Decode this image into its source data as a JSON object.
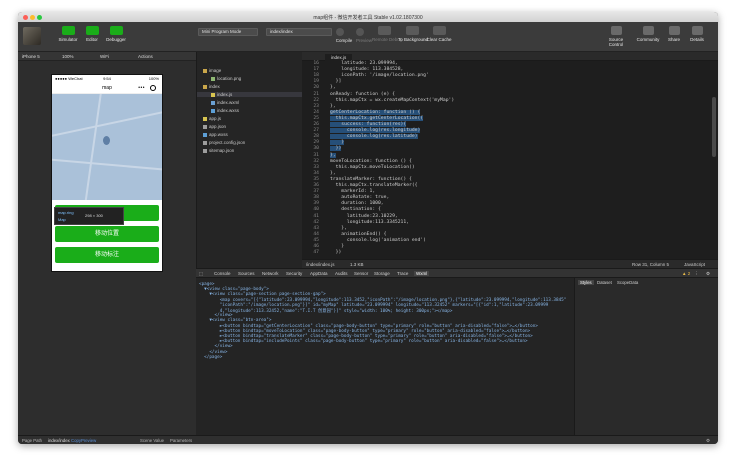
{
  "window": {
    "title": "map组件 - 微信开发者工具 Stable v1.02.1807300"
  },
  "toolbar": {
    "simulator": "Simulator",
    "editor": "Editor",
    "debugger": "Debugger",
    "mode": "Mini Program Mode",
    "page": "index/index",
    "compile": "Compile",
    "preview": "Preview",
    "remote": "Remote Debug",
    "background": "To Background",
    "clear": "Clear Cache",
    "source": "Source Control",
    "community": "Community",
    "share": "Share",
    "details": "Details"
  },
  "subbar": {
    "device": "iPhone 5",
    "zoom": "100%",
    "network": "WiFi",
    "actions": "Actions"
  },
  "phone": {
    "carrier": "●●●●● WeChat",
    "time": "9:54",
    "battery": "100%",
    "nav_title": "map",
    "nav_dots": "•••",
    "tooltip_a": "map.ring",
    "tooltip_b": "Map",
    "tooltip_size": "298 × 300",
    "buttons": [
      "获取位置",
      "移动位置",
      "移动标注"
    ]
  },
  "explorer": {
    "items": [
      {
        "label": "image",
        "kind": "folder"
      },
      {
        "label": "location.png",
        "kind": "png"
      },
      {
        "label": "index",
        "kind": "folder"
      },
      {
        "label": "index.js",
        "kind": "js"
      },
      {
        "label": "index.wxml",
        "kind": "wxml"
      },
      {
        "label": "index.wxss",
        "kind": "wxss"
      },
      {
        "label": "app.js",
        "kind": "js"
      },
      {
        "label": "app.json",
        "kind": "json"
      },
      {
        "label": "app.wxss",
        "kind": "wxss"
      },
      {
        "label": "project.config.json",
        "kind": "json"
      },
      {
        "label": "sitemap.json",
        "kind": "json"
      }
    ]
  },
  "editor": {
    "tab": "index.js",
    "lines": [
      {
        "n": "16",
        "t": "    latitude: 23.099994,",
        "hl": false
      },
      {
        "n": "17",
        "t": "    longitude: 113.384528,",
        "hl": false
      },
      {
        "n": "18",
        "t": "    iconPath: '/image/location.png'",
        "hl": false
      },
      {
        "n": "19",
        "t": "  }]",
        "hl": false
      },
      {
        "n": "20",
        "t": "},",
        "hl": false
      },
      {
        "n": "21",
        "t": "onReady: function (e) {",
        "hl": false
      },
      {
        "n": "22",
        "t": "  this.mapCtx = wx.createMapContext('myMap')",
        "hl": false
      },
      {
        "n": "23",
        "t": "},",
        "hl": false
      },
      {
        "n": "24",
        "t": "getCenterLocation: function () {",
        "hl": true
      },
      {
        "n": "25",
        "t": "  this.mapCtx.getCenterLocation({",
        "hl": true
      },
      {
        "n": "26",
        "t": "    success: function(res){",
        "hl": true
      },
      {
        "n": "27",
        "t": "      console.log(res.longitude)",
        "hl": true
      },
      {
        "n": "28",
        "t": "      console.log(res.latitude)",
        "hl": true
      },
      {
        "n": "29",
        "t": "    }",
        "hl": true
      },
      {
        "n": "30",
        "t": "  })",
        "hl": true
      },
      {
        "n": "31",
        "t": "},",
        "hl": true
      },
      {
        "n": "32",
        "t": "moveToLocation: function () {",
        "hl": false
      },
      {
        "n": "33",
        "t": "  this.mapCtx.moveToLocation()",
        "hl": false
      },
      {
        "n": "34",
        "t": "},",
        "hl": false
      },
      {
        "n": "35",
        "t": "translateMarker: function() {",
        "hl": false
      },
      {
        "n": "36",
        "t": "  this.mapCtx.translateMarker({",
        "hl": false
      },
      {
        "n": "37",
        "t": "    markerId: 1,",
        "hl": false
      },
      {
        "n": "38",
        "t": "    autoRotate: true,",
        "hl": false
      },
      {
        "n": "39",
        "t": "    duration: 1000,",
        "hl": false
      },
      {
        "n": "40",
        "t": "    destination: {",
        "hl": false
      },
      {
        "n": "41",
        "t": "      latitude:23.10229,",
        "hl": false
      },
      {
        "n": "42",
        "t": "      longitude:113.3345211,",
        "hl": false
      },
      {
        "n": "43",
        "t": "    },",
        "hl": false
      },
      {
        "n": "44",
        "t": "    animationEnd() {",
        "hl": false
      },
      {
        "n": "45",
        "t": "      console.log('animation end')",
        "hl": false
      },
      {
        "n": "46",
        "t": "    }",
        "hl": false
      },
      {
        "n": "47",
        "t": "  })",
        "hl": false
      }
    ],
    "path": "/index/index.js",
    "size": "1.3 KB",
    "position": "Row 31, Column 5",
    "language": "JavaScript"
  },
  "devtools": {
    "tabs": [
      "Console",
      "Sources",
      "Network",
      "Security",
      "AppData",
      "Audits",
      "Sensor",
      "Storage",
      "Trace",
      "Wxml"
    ],
    "active": "Wxml",
    "warn": "2",
    "wxml_lines": [
      "<page>",
      "  ▼<view class=\"page-body\">",
      "    ▼<view class=\"page-section page-section-gap\">",
      "        <map covers=\"[{\"latitude\":23.099994,\"longitude\":113.3452,\"iconPath\":\"/image/location.png\"},{\"latitude\":23.099994,\"longitude\":113.3845\"",
      "        \"iconPath\":\"/image/location.png\"}]\" id=\"myMap\" latitude=\"23.099994\" longitude=\"113.32452\" markers=\"[{\"id\":1,\"latitude\":23.09999",
      "        4,\"longitude\":113.32452,\"name\":\"T.I.T 创意园\"}]\" style=\"width: 100%; height: 300px;\"></map>",
      "      </view>",
      "    ▼<view class=\"btn-area\">",
      "        ►<button bindtap=\"getCenterLocation\" class=\"page-body-button\" type=\"primary\" role=\"button\" aria-disabled=\"false\">…</button>",
      "        ►<button bindtap=\"moveToLocation\" class=\"page-body-button\" type=\"primary\" role=\"button\" aria-disabled=\"false\">…</button>",
      "        ►<button bindtap=\"translateMarker\" class=\"page-body-button\" type=\"primary\" role=\"button\" aria-disabled=\"false\">…</button>",
      "        ►<button bindtap=\"includePoints\" class=\"page-body-button\" type=\"primary\" role=\"button\" aria-disabled=\"false\">…</button>",
      "      </view>",
      "    </view>",
      "  </page>"
    ],
    "style_tabs": [
      "Styles",
      "Dataset",
      "ScopeData"
    ]
  },
  "bottom": {
    "page_path": "Page Path",
    "path_value": "index/index",
    "copy": "Copy",
    "preview": "Preview",
    "scene": "Scene Value",
    "params": "Parameters"
  }
}
